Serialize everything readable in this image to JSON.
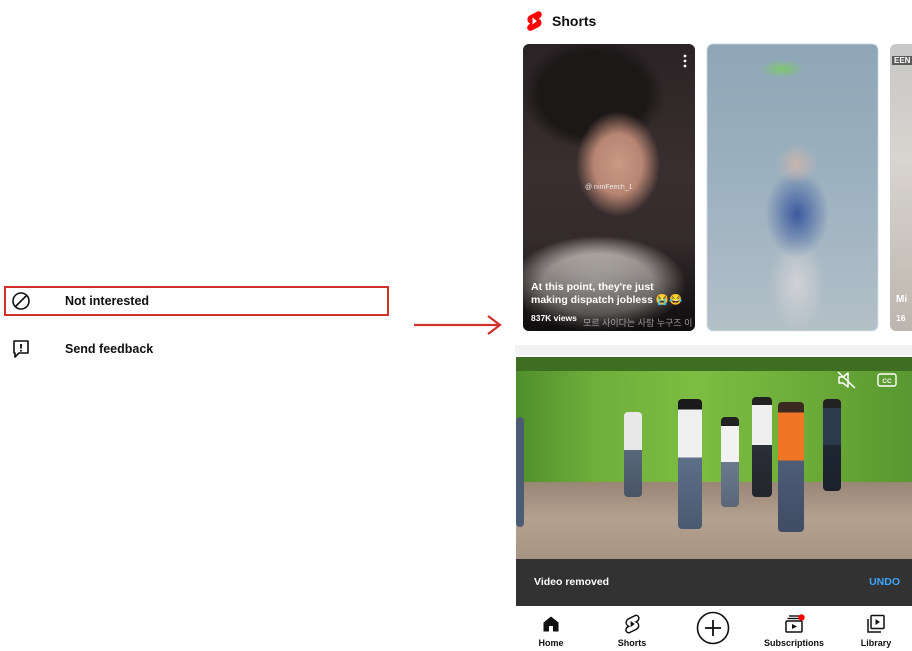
{
  "menu": {
    "items": [
      {
        "label": "Not interested",
        "icon": "block-icon"
      },
      {
        "label": "Send feedback",
        "icon": "feedback-icon"
      }
    ]
  },
  "shorts": {
    "title": "Shorts",
    "cards": [
      {
        "title": "At this point, they're just making dispatch jobless 😭😂",
        "views": "837K views",
        "watermark": "@ nimFeech_1",
        "overlay_text": "모르 사이다는 사람 누구즈 이"
      },
      {
        "title": "",
        "views": ""
      },
      {
        "badge": "EEN",
        "title": "Mi",
        "views": "16"
      }
    ]
  },
  "snackbar": {
    "message": "Video removed",
    "action": "UNDO"
  },
  "nav": {
    "items": [
      {
        "label": "Home",
        "icon": "home-icon"
      },
      {
        "label": "Shorts",
        "icon": "shorts-icon"
      },
      {
        "label": "",
        "icon": "create-icon"
      },
      {
        "label": "Subscriptions",
        "icon": "subscriptions-icon"
      },
      {
        "label": "Library",
        "icon": "library-icon"
      }
    ]
  },
  "colors": {
    "highlight": "#d0312d",
    "brand_red": "#ff0000",
    "undo": "#3ea6ff",
    "snackbar_bg": "#323232"
  }
}
